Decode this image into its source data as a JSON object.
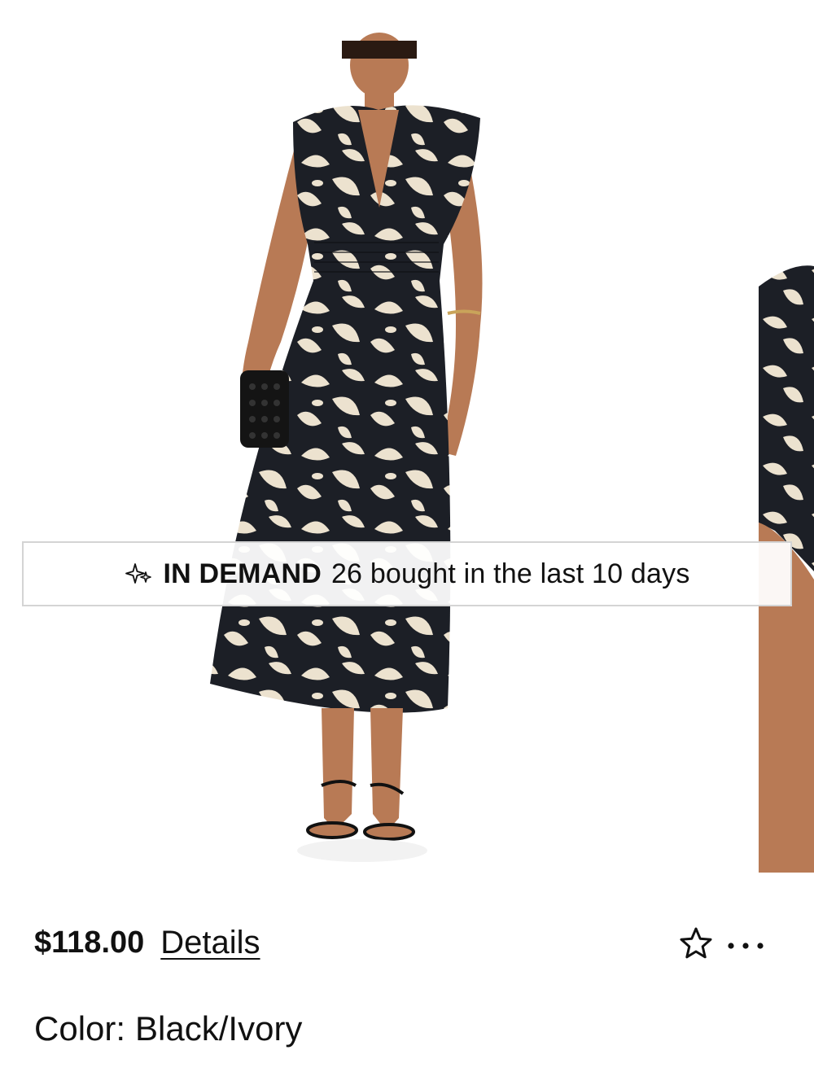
{
  "gallery": {
    "main_image_alt": "Model wearing black and ivory floral print sleeveless midi dress",
    "next_image_alt": "Dress detail close-up"
  },
  "badge": {
    "icon": "sparkle-icon",
    "title": "IN DEMAND",
    "text": "26 bought in the last 10 days"
  },
  "product": {
    "price": "$118.00",
    "details_label": "Details",
    "color_label": "Color:",
    "color_value": "Black/Ivory"
  },
  "actions": {
    "favorite_icon": "star-outline-icon",
    "more_icon": "ellipsis-icon"
  },
  "colors": {
    "print_dark": "#1c1f26",
    "print_light": "#ece2cf",
    "skin": "#c08660",
    "text": "#111111"
  }
}
